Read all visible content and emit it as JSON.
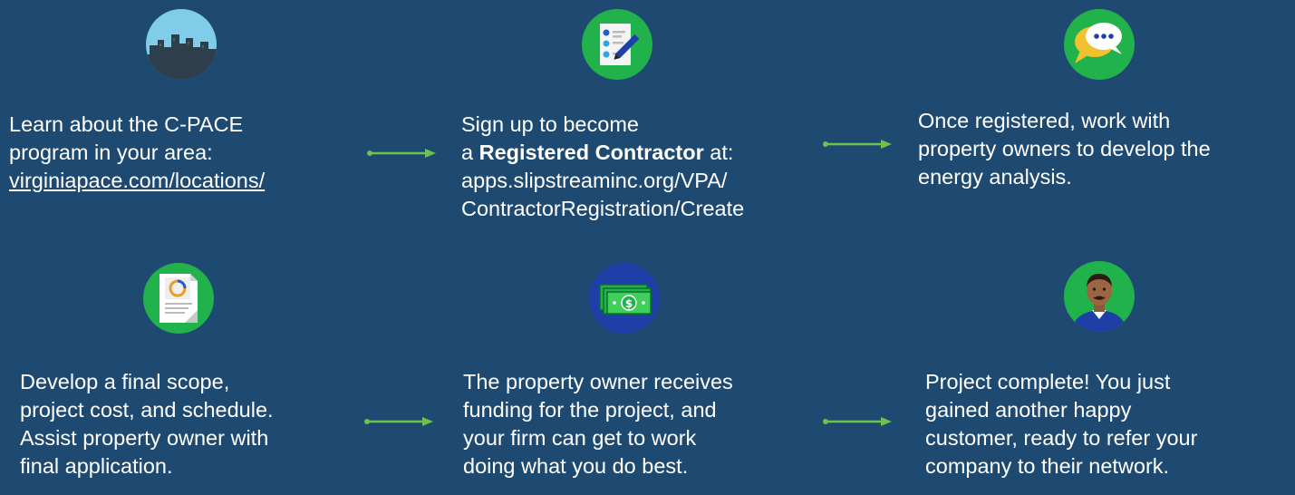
{
  "colors": {
    "background": "#1e4a71",
    "text": "#ffffff",
    "arrow": "#6cc24a",
    "icon_green": "#2eb82e",
    "icon_blue": "#1f3fa8"
  },
  "steps": [
    {
      "icon": "city-skyline-icon",
      "line1": "Learn about the C-PACE",
      "line2": "program in your area:",
      "link": "virginiapace.com/locations/"
    },
    {
      "icon": "checklist-pen-icon",
      "line1": "Sign up to become",
      "line2_pre": "a ",
      "line2_bold": "Registered Contractor",
      "line2_post": " at:",
      "line3": "apps.slipstreaminc.org/VPA/",
      "line4": "ContractorRegistration/Create"
    },
    {
      "icon": "chat-bubbles-icon",
      "line1": "Once registered, work with",
      "line2": "property owners to develop the",
      "line3": "energy analysis."
    },
    {
      "icon": "report-document-icon",
      "line1": "Develop a final scope,",
      "line2": "project cost, and schedule.",
      "line3": "Assist property owner with",
      "line4": "final application."
    },
    {
      "icon": "money-stack-icon",
      "line1": "The property owner receives",
      "line2": "funding for the project, and",
      "line3": "your firm can get to work",
      "line4": "doing what you do best."
    },
    {
      "icon": "happy-customer-icon",
      "line1": "Project complete! You just",
      "line2": "gained another happy",
      "line3": "customer, ready to refer your",
      "line4": "company to their network."
    }
  ]
}
